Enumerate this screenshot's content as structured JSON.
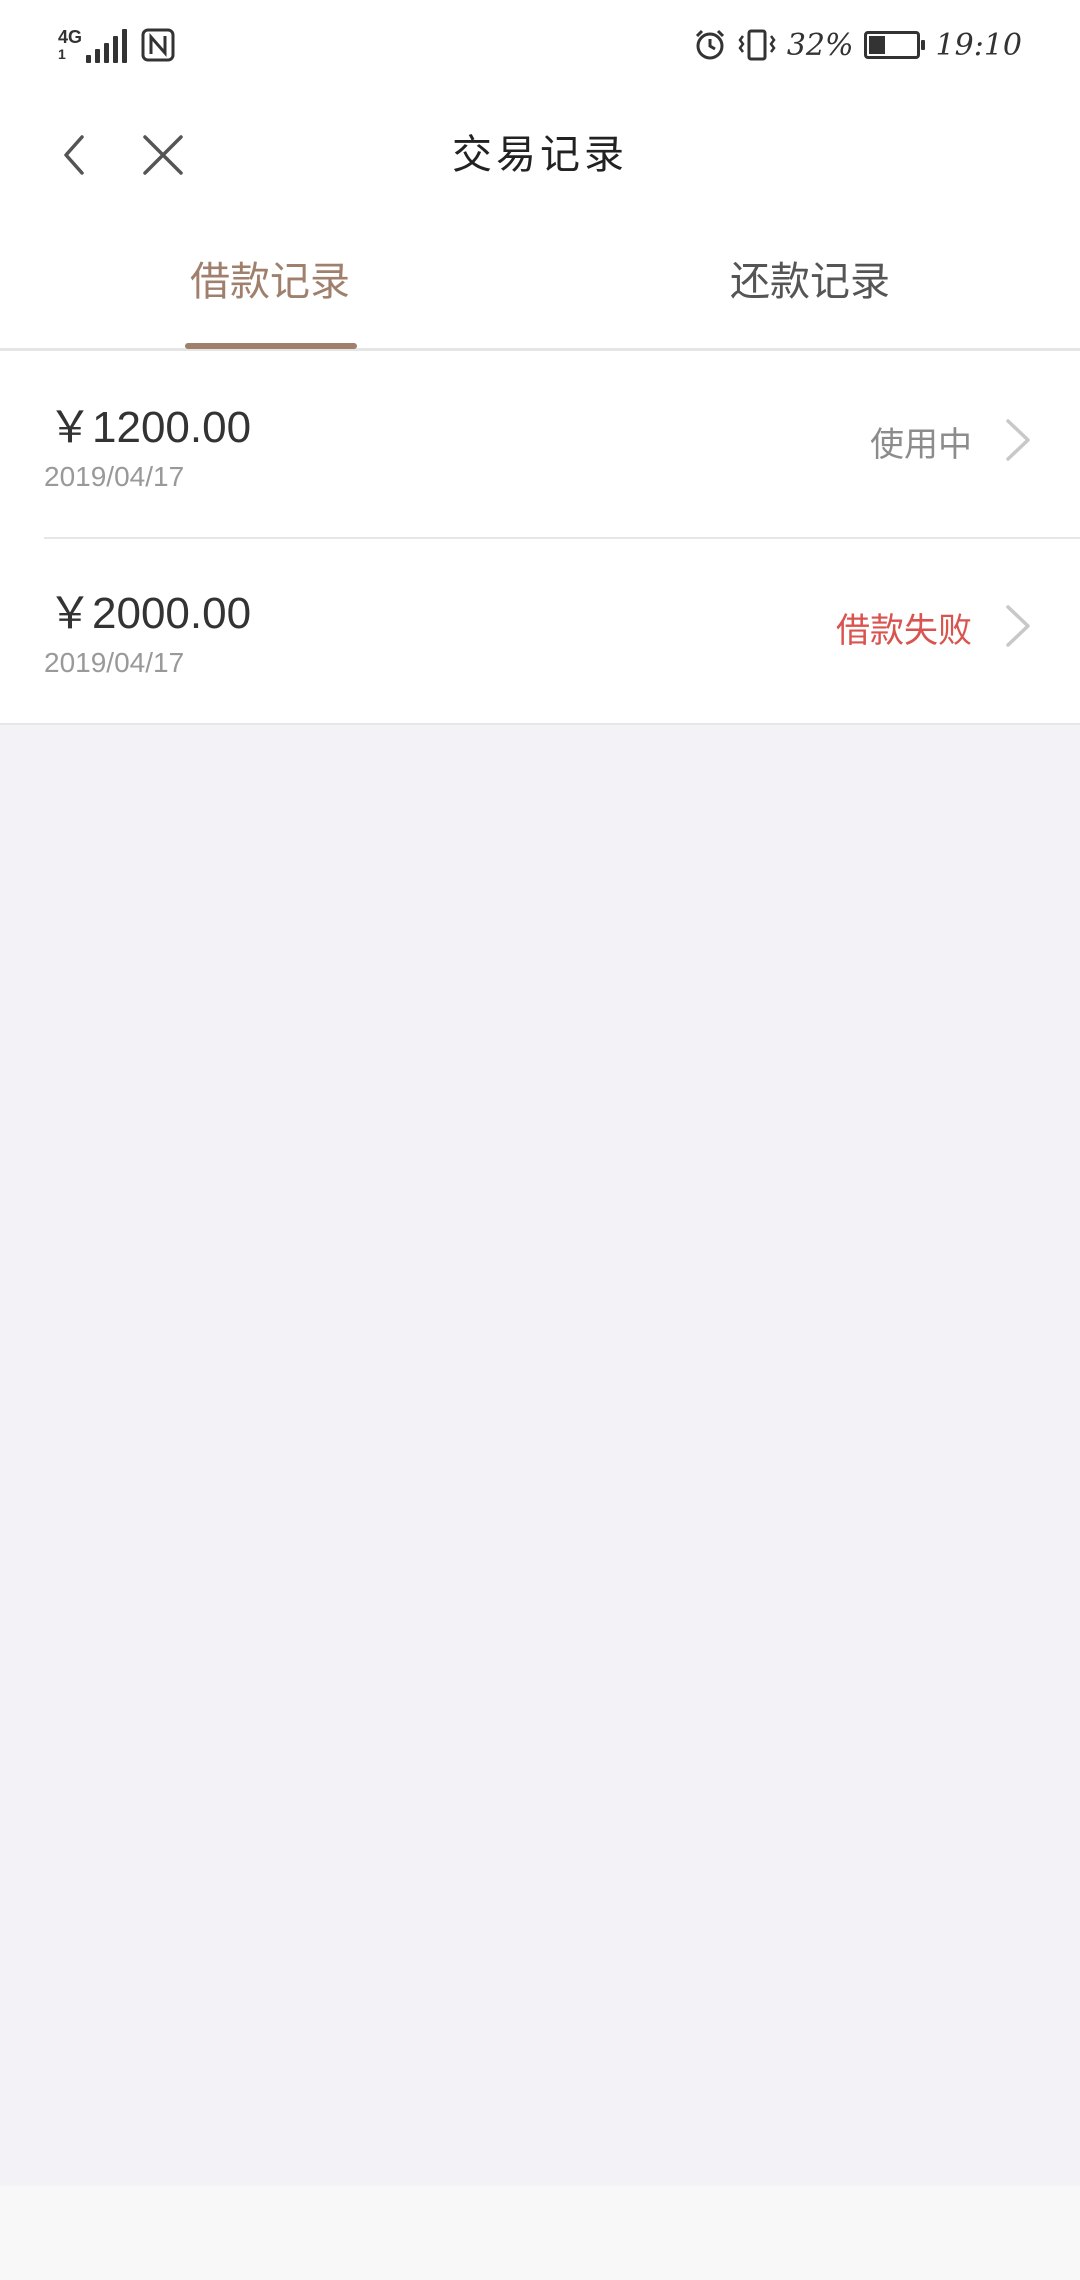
{
  "status_bar": {
    "network": "4G",
    "network_sub": "1",
    "battery": "32%",
    "time": "19:10",
    "icons": [
      "signal-icon",
      "nfc-icon",
      "alarm-icon",
      "vibrate-icon",
      "battery-icon"
    ]
  },
  "nav": {
    "title": "交易记录",
    "back_icon": "chevron-left-icon",
    "close_icon": "close-icon"
  },
  "tabs": [
    {
      "label": "借款记录",
      "active": true
    },
    {
      "label": "还款记录",
      "active": false
    }
  ],
  "records": [
    {
      "amount": "￥1200.00",
      "date": "2019/04/17",
      "status": "使用中",
      "status_color": "#8c8c8c"
    },
    {
      "amount": "￥2000.00",
      "date": "2019/04/17",
      "status": "借款失败",
      "status_color": "#d9534f"
    }
  ],
  "colors": {
    "accent": "#a0806d",
    "fail": "#d9534f",
    "background": "#f2f2f7"
  }
}
